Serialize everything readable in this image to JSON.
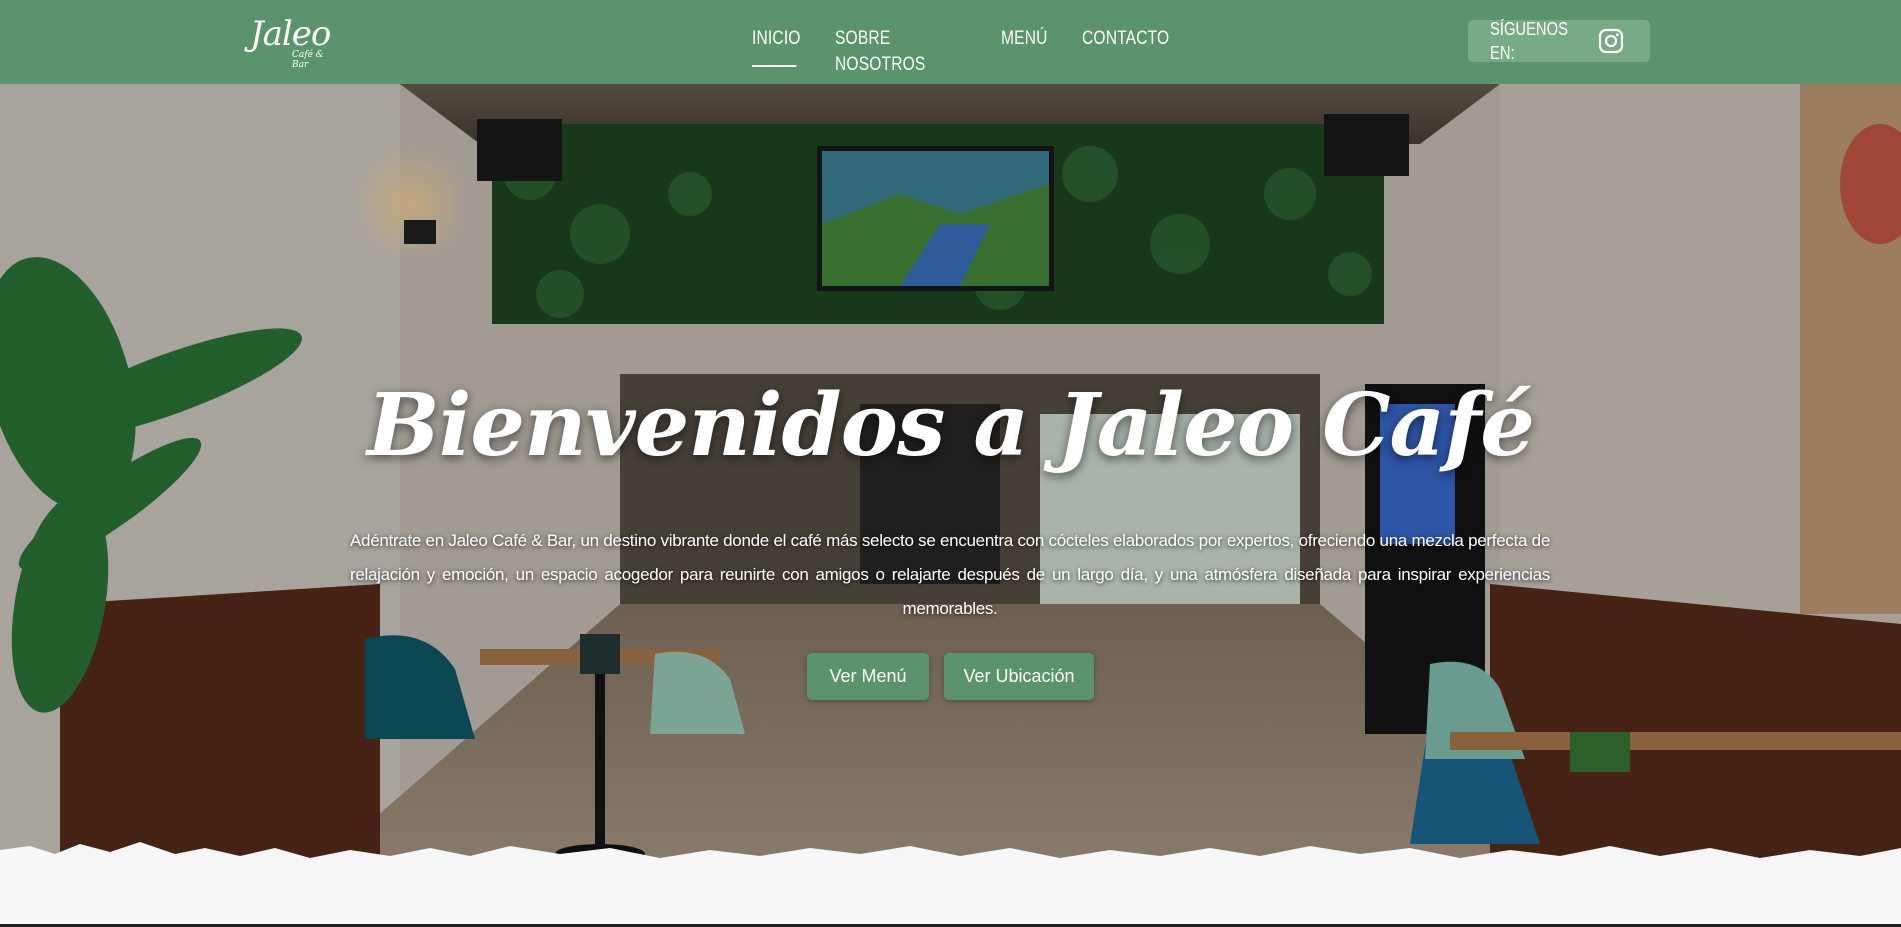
{
  "header": {
    "logo_text": "Jaleo",
    "logo_subtext": "Café & Bar",
    "nav": [
      {
        "label": "INICIO",
        "active": true
      },
      {
        "label": "SOBRE NOSOTROS",
        "active": false
      },
      {
        "label": "MENÚ",
        "active": false
      },
      {
        "label": "CONTACTO",
        "active": false
      }
    ],
    "follow_label": "SÍGUENOS EN:",
    "social_icon": "instagram-icon"
  },
  "hero": {
    "title": "Bienvenidos a Jaleo Café",
    "description": "Adéntrate en Jaleo Café & Bar, un destino vibrante donde el café más selecto se encuentra con cócteles elaborados por expertos, ofreciendo una mezcla perfecta de relajación y emoción, un espacio acogedor para reunirte con amigos o relajarte después de un largo día, y una atmósfera diseñada para inspirar experiencias memorables.",
    "buttons": [
      {
        "label": "Ver Menú"
      },
      {
        "label": "Ver Ubicación"
      }
    ]
  },
  "colors": {
    "brand_green": "#5a936c",
    "follow_bg": "#79aa88",
    "text": "#ffffff"
  }
}
